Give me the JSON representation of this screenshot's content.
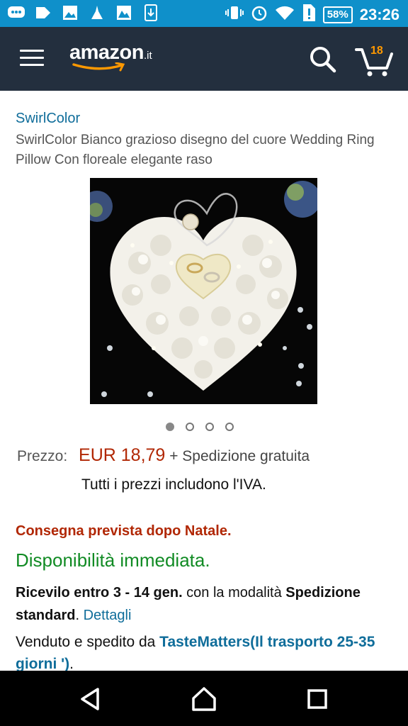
{
  "status_bar": {
    "battery": "58%",
    "time": "23:26"
  },
  "header": {
    "logo_text": "amazon",
    "logo_tld": ".it",
    "cart_count": "18",
    "brand_color": "#232f3e",
    "accent_color": "#ff9900"
  },
  "product": {
    "brand": "SwirlColor",
    "title": "SwirlColor Bianco grazioso disegno del cuore Wedding Ring Pillow Con floreale elegante raso",
    "image_icon": "heart-ring-pillow-image",
    "image_count": 4,
    "active_image": 1
  },
  "pricing": {
    "label": "Prezzo:",
    "price": "EUR 18,79",
    "shipping": "+ Spedizione gratuita",
    "vat_note": "Tutti i prezzi includono l'IVA.",
    "price_color": "#b12704"
  },
  "delivery": {
    "note": "Consegna prevista dopo Natale.",
    "availability": "Disponibilità immediata.",
    "receive_prefix": "Ricevilo entro 3 - 14 gen.",
    "receive_mid": " con la modalità ",
    "receive_method": "Spedizione standard",
    "receive_period": ". ",
    "details_link": "Dettagli",
    "availability_color": "#118b24"
  },
  "seller": {
    "prefix": "Venduto e spedito da ",
    "name": "TasteMatters(Il trasporto 25-35 giorni ')",
    "suffix": "."
  }
}
